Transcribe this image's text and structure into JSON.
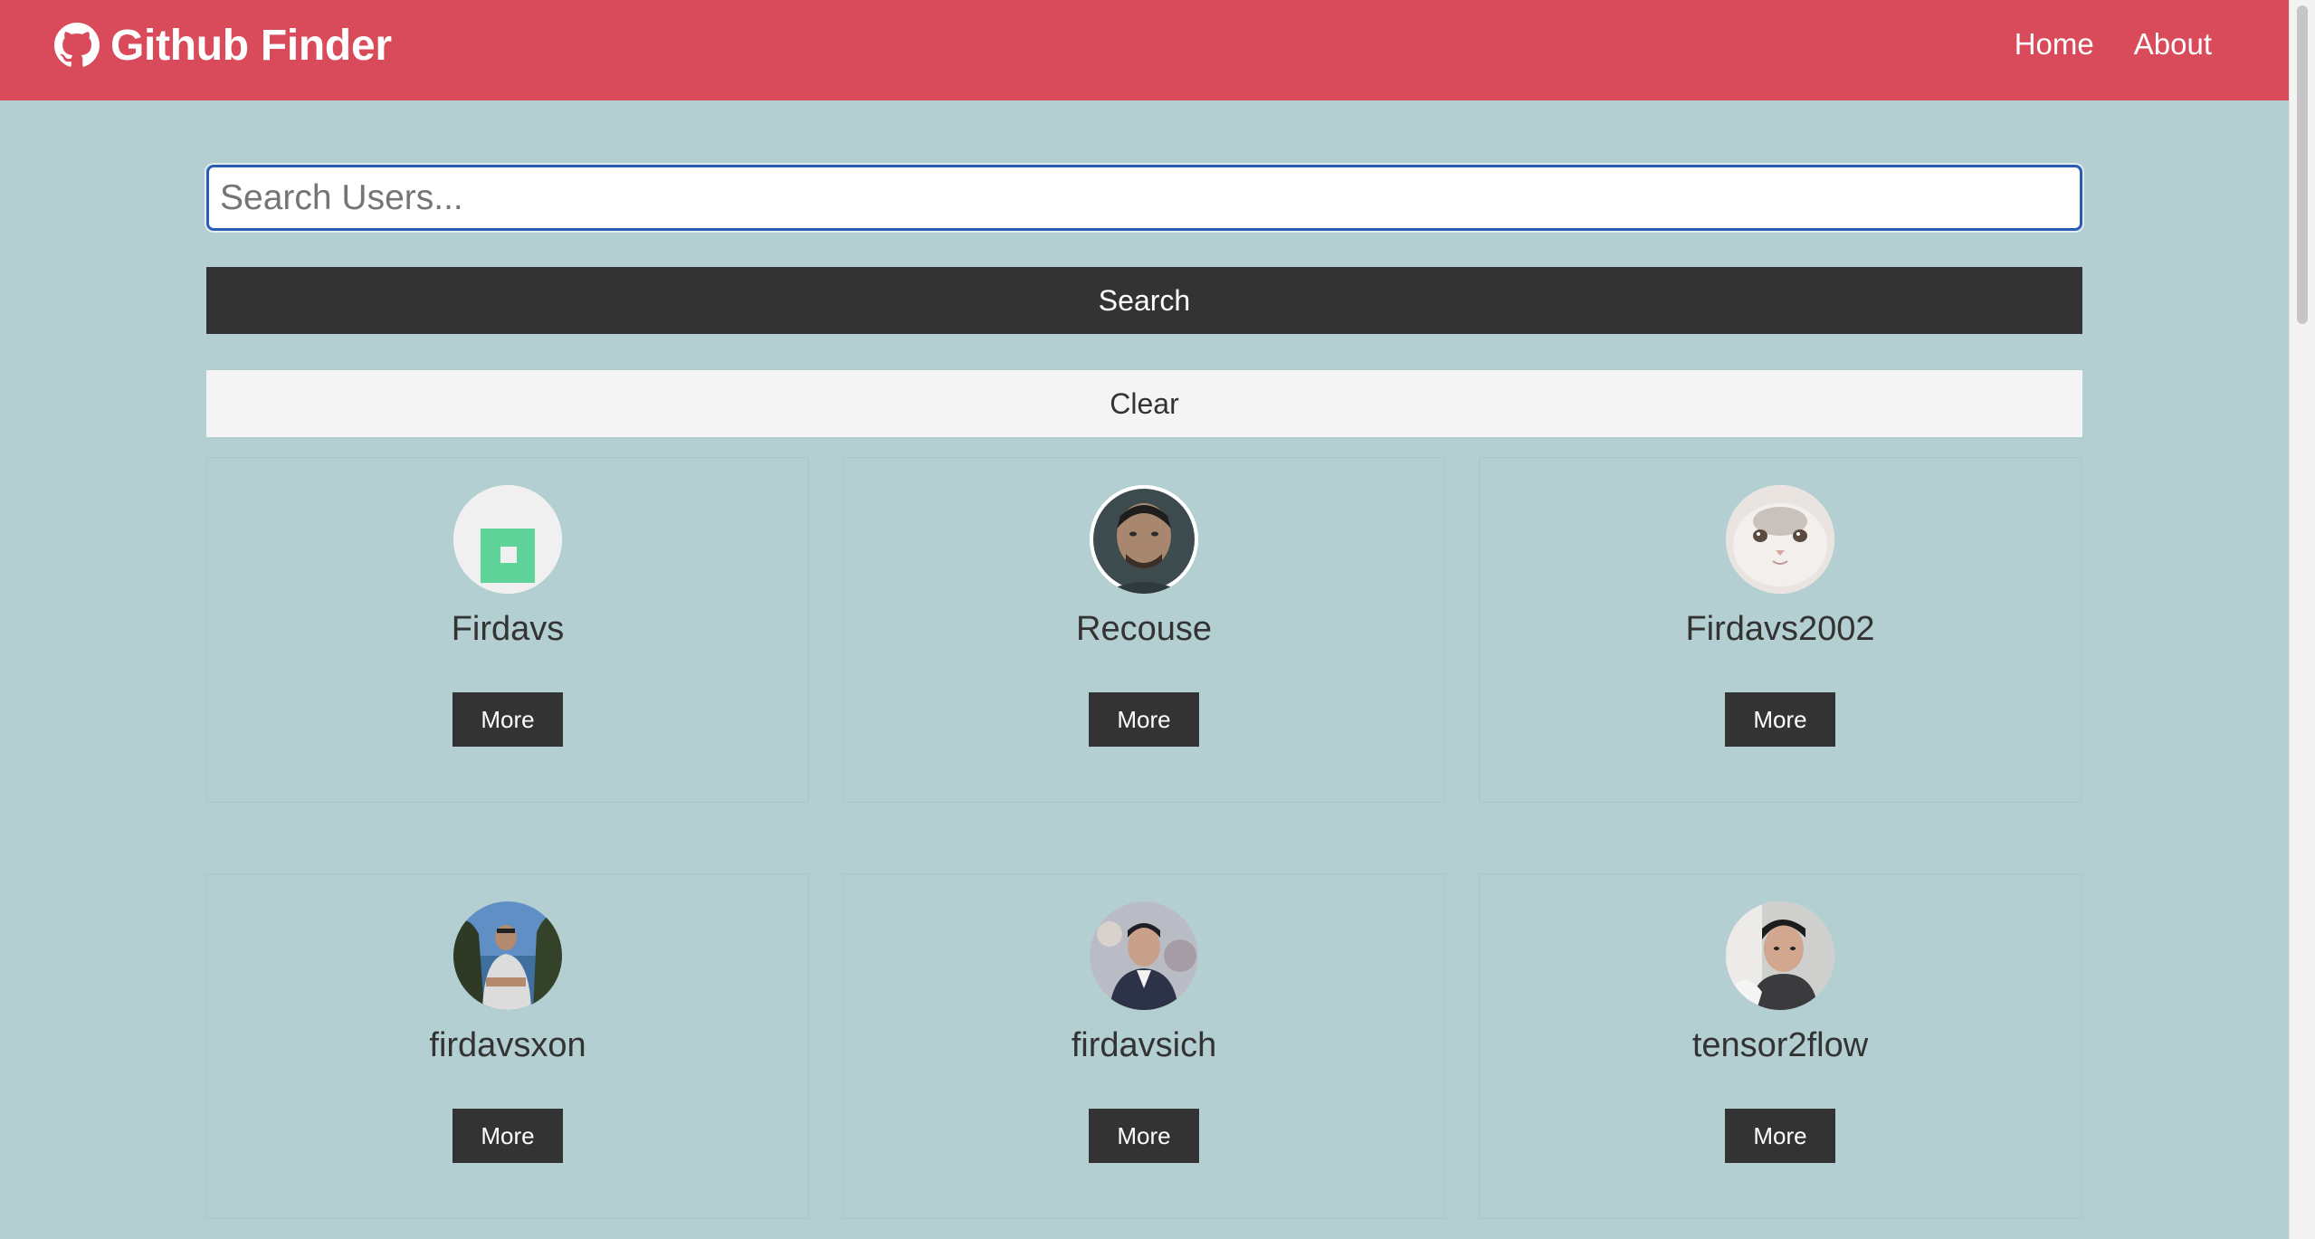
{
  "navbar": {
    "brand": "Github Finder",
    "links": [
      "Home",
      "About"
    ]
  },
  "search": {
    "placeholder": "Search Users...",
    "value": "",
    "search_label": "Search",
    "clear_label": "Clear"
  },
  "users": [
    {
      "login": "Firdavs",
      "button": "More"
    },
    {
      "login": "Recouse",
      "button": "More"
    },
    {
      "login": "Firdavs2002",
      "button": "More"
    },
    {
      "login": "firdavsxon",
      "button": "More"
    },
    {
      "login": "firdavsich",
      "button": "More"
    },
    {
      "login": "tensor2flow",
      "button": "More"
    }
  ],
  "colors": {
    "navbar": "#d94a5a",
    "page_background": "#b3cfd1",
    "dark_button": "#333333",
    "light_button": "#f4f4f4",
    "input_border": "#2a5bb5"
  }
}
